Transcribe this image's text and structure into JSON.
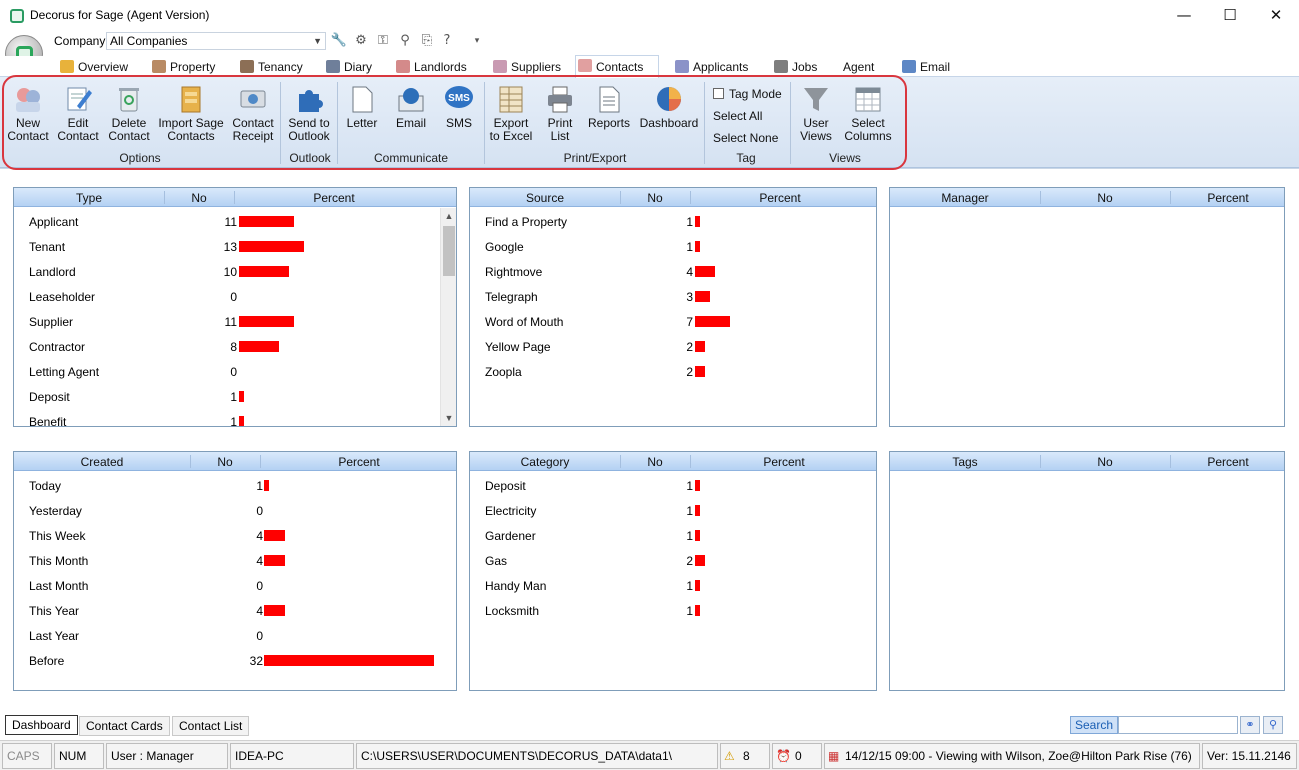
{
  "window": {
    "title": "Decorus for Sage (Agent Version)",
    "minimize": "—",
    "maximize": "☐",
    "close": "✕"
  },
  "header": {
    "company_label": "Company",
    "company_value": "All Companies"
  },
  "tabs": [
    {
      "label": "Overview",
      "icon": "overview-icon",
      "color": "#e8b23b"
    },
    {
      "label": "Property",
      "icon": "property-icon",
      "color": "#b98b64"
    },
    {
      "label": "Tenancy",
      "icon": "tenancy-icon",
      "color": "#8c6f56"
    },
    {
      "label": "Diary",
      "icon": "diary-icon",
      "color": "#6f7f9a"
    },
    {
      "label": "Landlords",
      "icon": "landlords-icon",
      "color": "#d48a8a"
    },
    {
      "label": "Suppliers",
      "icon": "suppliers-icon",
      "color": "#c99ab2"
    },
    {
      "label": "Contacts",
      "icon": "contacts-icon",
      "color": "#e1a0a0"
    },
    {
      "label": "Applicants",
      "icon": "applicants-icon",
      "color": "#8b92c8"
    },
    {
      "label": "Jobs",
      "icon": "jobs-icon",
      "color": "#7e7e7e"
    },
    {
      "label": "Agent",
      "icon": "",
      "color": ""
    },
    {
      "label": "Email",
      "icon": "email-icon",
      "color": "#5d87c5"
    }
  ],
  "ribbon": {
    "new_contact": "New\nContact",
    "edit_contact": "Edit\nContact",
    "delete_contact": "Delete\nContact",
    "import_sage": "Import Sage\nContacts",
    "contact_receipt": "Contact\nReceipt",
    "send_outlook": "Send to\nOutlook",
    "letter": "Letter",
    "email": "Email",
    "sms": "SMS",
    "sms_badge": "SMS",
    "export_excel": "Export\nto Excel",
    "print_list": "Print\nList",
    "reports": "Reports",
    "dashboard": "Dashboard",
    "tag_mode": "Tag Mode",
    "select_all": "Select All",
    "select_none": "Select None",
    "user_views": "User\nViews",
    "select_columns": "Select\nColumns",
    "groups": {
      "options": "Options",
      "outlook": "Outlook",
      "communicate": "Communicate",
      "print_export": "Print/Export",
      "tag": "Tag",
      "views": "Views"
    }
  },
  "panels": {
    "type": {
      "headers": [
        "Type",
        "No",
        "Percent"
      ],
      "rows": [
        {
          "label": "Applicant",
          "no": "11",
          "value": 11
        },
        {
          "label": "Tenant",
          "no": "13",
          "value": 13
        },
        {
          "label": "Landlord",
          "no": "10",
          "value": 10
        },
        {
          "label": "Leaseholder",
          "no": "0",
          "value": 0
        },
        {
          "label": "Supplier",
          "no": "11",
          "value": 11
        },
        {
          "label": "Contractor",
          "no": "8",
          "value": 8
        },
        {
          "label": "Letting Agent",
          "no": "0",
          "value": 0
        },
        {
          "label": "Deposit",
          "no": "1",
          "value": 1
        },
        {
          "label": "Benefit",
          "no": "1",
          "value": 1
        }
      ]
    },
    "source": {
      "headers": [
        "Source",
        "No",
        "Percent"
      ],
      "rows": [
        {
          "label": "Find a Property",
          "no": "1",
          "value": 1
        },
        {
          "label": "Google",
          "no": "1",
          "value": 1
        },
        {
          "label": "Rightmove",
          "no": "4",
          "value": 4
        },
        {
          "label": "Telegraph",
          "no": "3",
          "value": 3
        },
        {
          "label": "Word of Mouth",
          "no": "7",
          "value": 7
        },
        {
          "label": "Yellow Page",
          "no": "2",
          "value": 2
        },
        {
          "label": "Zoopla",
          "no": "2",
          "value": 2
        }
      ]
    },
    "manager": {
      "headers": [
        "Manager",
        "No",
        "Percent"
      ],
      "rows": []
    },
    "created": {
      "headers": [
        "Created",
        "No",
        "Percent"
      ],
      "rows": [
        {
          "label": "Today",
          "no": "1",
          "value": 1
        },
        {
          "label": "Yesterday",
          "no": "0",
          "value": 0
        },
        {
          "label": "This Week",
          "no": "4",
          "value": 4
        },
        {
          "label": "This Month",
          "no": "4",
          "value": 4
        },
        {
          "label": "Last Month",
          "no": "0",
          "value": 0
        },
        {
          "label": "This Year",
          "no": "4",
          "value": 4
        },
        {
          "label": "Last Year",
          "no": "0",
          "value": 0
        },
        {
          "label": "Before",
          "no": "32",
          "value": 32
        }
      ]
    },
    "category": {
      "headers": [
        "Category",
        "No",
        "Percent"
      ],
      "rows": [
        {
          "label": "Deposit",
          "no": "1",
          "value": 1
        },
        {
          "label": "Electricity",
          "no": "1",
          "value": 1
        },
        {
          "label": "Gardener",
          "no": "1",
          "value": 1
        },
        {
          "label": "Gas",
          "no": "2",
          "value": 2
        },
        {
          "label": "Handy Man",
          "no": "1",
          "value": 1
        },
        {
          "label": "Locksmith",
          "no": "1",
          "value": 1
        }
      ]
    },
    "tags": {
      "headers": [
        "Tags",
        "No",
        "Percent"
      ],
      "rows": []
    }
  },
  "bottom_tabs": [
    "Dashboard",
    "Contact Cards",
    "Contact List"
  ],
  "search": {
    "label": "Search",
    "value": ""
  },
  "status": {
    "caps": "CAPS",
    "num": "NUM",
    "user": "User : Manager",
    "pc": "IDEA-PC",
    "path": "C:\\USERS\\USER\\DOCUMENTS\\DECORUS_DATA\\data1\\",
    "warnings": "8",
    "alarms": "0",
    "appointment": "14/12/15 09:00 - Viewing with Wilson, Zoe@Hilton Park Rise (76)",
    "version": "Ver: 15.11.2146"
  },
  "colors": {
    "bar": "#ff0000",
    "header": "#b4d1f3",
    "ribbon": "#dce7f5",
    "highlight": "#d9363e"
  }
}
